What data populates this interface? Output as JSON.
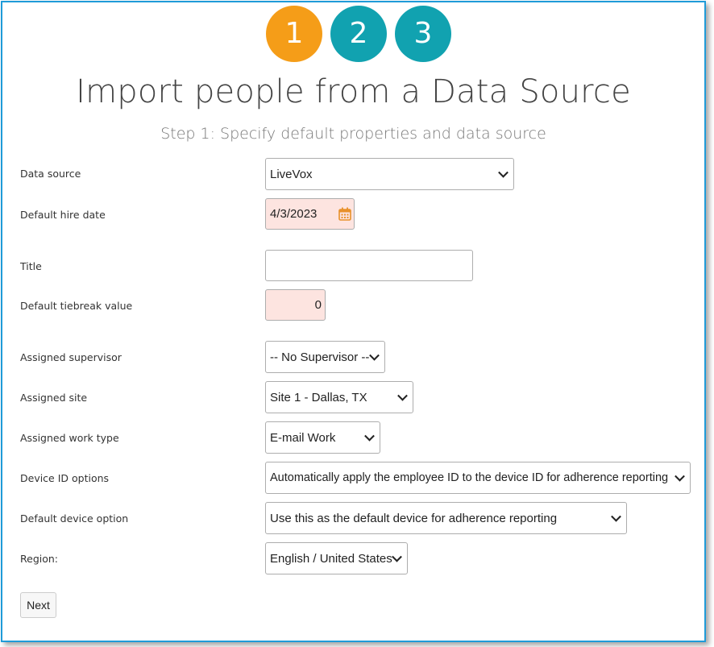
{
  "steps": [
    {
      "label": "1",
      "state": "active",
      "color": "#f59d18"
    },
    {
      "label": "2",
      "state": "pending",
      "color": "#11a2b0"
    },
    {
      "label": "3",
      "state": "pending",
      "color": "#11a2b0"
    }
  ],
  "page_title": "Import people from a Data Source",
  "subtitle": "Step 1: Specify default properties and data source",
  "form": {
    "data_source": {
      "label": "Data source",
      "value": "LiveVox"
    },
    "hire_date": {
      "label": "Default hire date",
      "value": "4/3/2023",
      "icon": "calendar-icon"
    },
    "title": {
      "label": "Title",
      "value": ""
    },
    "tiebreak": {
      "label": "Default tiebreak value",
      "value": "0"
    },
    "supervisor": {
      "label": "Assigned supervisor",
      "value": "-- No Supervisor --"
    },
    "site": {
      "label": "Assigned site",
      "value": "Site 1 - Dallas, TX"
    },
    "work_type": {
      "label": "Assigned work type",
      "value": "E-mail Work"
    },
    "device_id": {
      "label": "Device ID options",
      "value": "Automatically apply the employee ID to the device ID for adherence reporting"
    },
    "device_option": {
      "label": "Default device option",
      "value": "Use this as the default device for adherence reporting"
    },
    "region": {
      "label": "Region:",
      "value": "English / United States"
    }
  },
  "next_label": "Next",
  "colors": {
    "frame_border": "#1f9bd8",
    "invalid_field": "#fde4e0",
    "calendar_icon": "#e8912a"
  }
}
